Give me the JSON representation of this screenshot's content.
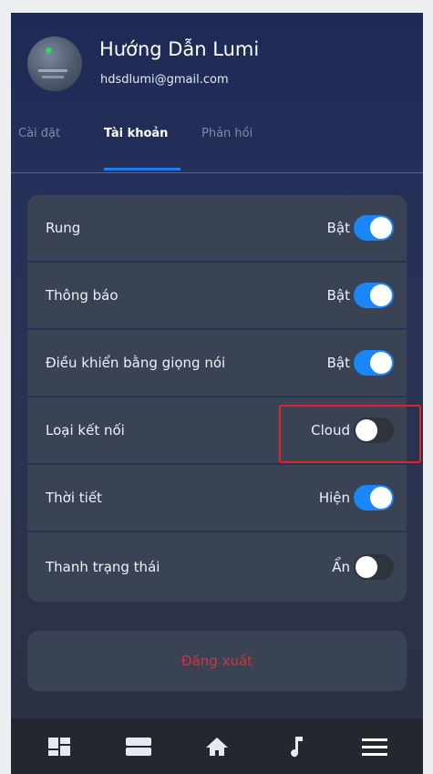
{
  "user": {
    "name": "Hướng Dẫn Lumi",
    "email": "hdsdlumi@gmail.com"
  },
  "tabs": [
    {
      "label": "Cài đặt",
      "active": false
    },
    {
      "label": "Tài khoản",
      "active": true
    },
    {
      "label": "Phản hồi",
      "active": false
    }
  ],
  "settings": [
    {
      "label": "Rung",
      "value": "Bật",
      "on": true
    },
    {
      "label": "Thông báo",
      "value": "Bật",
      "on": true
    },
    {
      "label": "Điều khiển bằng giọng nói",
      "value": "Bật",
      "on": true
    },
    {
      "label": "Loại kết nối",
      "value": "Cloud",
      "on": false
    },
    {
      "label": "Thời tiết",
      "value": "Hiện",
      "on": true
    },
    {
      "label": "Thanh trạng thái",
      "value": "Ẩn",
      "on": false
    }
  ],
  "logout_label": "Đăng xuất",
  "bottom_nav": [
    {
      "icon": "dashboard-icon"
    },
    {
      "icon": "devices-icon"
    },
    {
      "icon": "home-icon"
    },
    {
      "icon": "music-note-icon"
    },
    {
      "icon": "menu-icon"
    }
  ],
  "colors": {
    "accent": "#1a86f7",
    "danger": "#d0343f",
    "highlight_border": "#e0232b"
  }
}
